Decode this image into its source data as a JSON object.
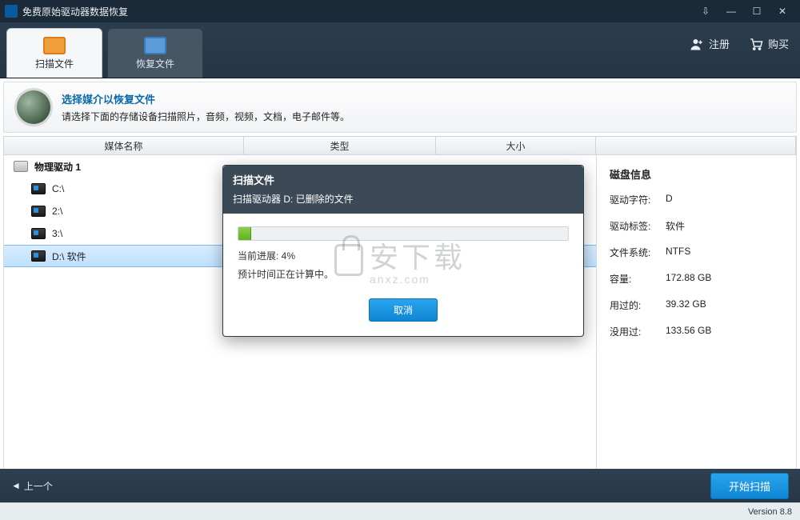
{
  "titlebar": {
    "title": "免费原始驱动器数据恢复"
  },
  "header": {
    "tabs": [
      {
        "label": "扫描文件",
        "active": true
      },
      {
        "label": "恢复文件",
        "active": false
      }
    ],
    "register": "注册",
    "buy": "购买"
  },
  "info": {
    "title": "选择媒介以恢复文件",
    "subtitle": "请选择下面的存储设备扫描照片，音频，视频，文档，电子邮件等。"
  },
  "columns": {
    "name": "媒体名称",
    "type": "类型",
    "size": "大小"
  },
  "drives": {
    "physical_label": "物理驱动 1",
    "volumes": [
      {
        "label": "C:\\",
        "selected": false
      },
      {
        "label": "2:\\",
        "selected": false
      },
      {
        "label": "3:\\",
        "selected": false
      },
      {
        "label": "D:\\ 软件",
        "selected": true
      }
    ]
  },
  "disk_info": {
    "heading": "磁盘信息",
    "rows": {
      "letter_k": "驱动字符:",
      "letter_v": "D",
      "label_k": "驱动标签:",
      "label_v": "软件",
      "fs_k": "文件系统:",
      "fs_v": "NTFS",
      "cap_k": "容量:",
      "cap_v": "172.88 GB",
      "used_k": "用过的:",
      "used_v": "39.32 GB",
      "free_k": "没用过:",
      "free_v": "133.56 GB"
    }
  },
  "modal": {
    "title": "扫描文件",
    "subtitle": "扫描驱动器 D: 已删除的文件",
    "progress_percent": 4,
    "progress_line": "当前进展:   4%",
    "eta_line": "预计时间正在计算中。",
    "cancel": "取消"
  },
  "bottom": {
    "prev": "上一个",
    "scan": "开始扫描"
  },
  "version": "Version 8.8",
  "watermark": {
    "main": "安下载",
    "sub": "anxz.com"
  }
}
